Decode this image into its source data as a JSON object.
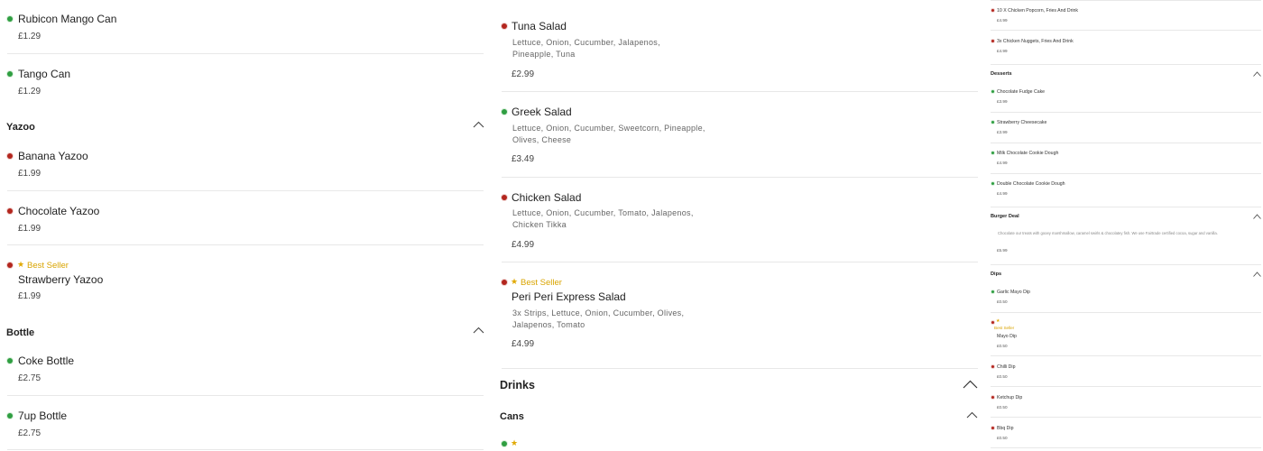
{
  "col1": {
    "items_top": [
      {
        "name": "Rubicon Mango Can",
        "price": "£1.29"
      },
      {
        "name": "Tango Can",
        "price": "£1.29"
      }
    ],
    "yazoo": {
      "title": "Yazoo",
      "items": [
        {
          "name": "Banana Yazoo",
          "price": "£1.99"
        },
        {
          "name": "Chocolate Yazoo",
          "price": "£1.99"
        },
        {
          "badge": "Best Seller",
          "name": "Strawberry Yazoo",
          "price": "£1.99"
        }
      ]
    },
    "bottle": {
      "title": "Bottle",
      "items": [
        {
          "name": "Coke Bottle",
          "price": "£2.75"
        },
        {
          "name": "7up Bottle",
          "price": "£2.75"
        }
      ]
    }
  },
  "col2": {
    "items": [
      {
        "name": "Tuna Salad",
        "desc": "Lettuce, Onion, Cucumber, Jalapenos, Pineapple, Tuna",
        "price": "£2.99"
      },
      {
        "name": "Greek Salad",
        "desc": "Lettuce, Onion, Cucumber, Sweetcorn, Pineapple, Olives, Cheese",
        "price": "£3.49"
      },
      {
        "name": "Chicken Salad",
        "desc": "Lettuce, Onion, Cucumber, Tomato, Jalapenos, Chicken Tikka",
        "price": "£4.99"
      },
      {
        "badge": "Best Seller",
        "name": "Peri Peri Express Salad",
        "desc": "3x Strips, Lettuce, Onion, Cucumber, Olives, Jalapenos, Tomato",
        "price": "£4.99"
      }
    ],
    "drinks_title": "Drinks",
    "cans_title": "Cans"
  },
  "col3": {
    "top_items": [
      {
        "name": "10 X Chicken Popcorn, Fries And Drink",
        "price": "£4.99"
      },
      {
        "name": "3x Chicken Nuggets, Fries And Drink",
        "price": "£4.99"
      }
    ],
    "desserts": {
      "title": "Desserts",
      "items": [
        {
          "name": "Chocolate Fudge Cake",
          "price": "£3.99"
        },
        {
          "name": "Strawberry Cheesecake",
          "price": "£3.99"
        },
        {
          "name": "Milk Chocolate Cookie Dough",
          "price": "£4.99"
        },
        {
          "name": "Double Chocolate Cookie Dough",
          "price": "£4.99"
        }
      ]
    },
    "burger_deal": {
      "title": "Burger Deal",
      "desc": "Chocolate our treats with gooey marshmallow, caramel swirls & chocolatey fish. We use Fairtrade certified cocoa, sugar and vanilla.",
      "price": "£5.99"
    },
    "dips": {
      "title": "Dips",
      "items": [
        {
          "name": "Garlic Mayo Dip",
          "price": "£0.50"
        },
        {
          "badge": "Best Seller",
          "name": "Mayo Dip",
          "price": "£0.50"
        },
        {
          "name": "Chilli Dip",
          "price": "£0.50"
        },
        {
          "name": "Ketchup Dip",
          "price": "£0.50"
        },
        {
          "name": "Bbq Dip",
          "price": "£0.50"
        }
      ]
    }
  },
  "colors": {
    "veg": "#2f9e41",
    "nonveg": "#b3261e",
    "bestseller": "#d9a400",
    "divider": "#e8e8e8"
  },
  "icons": {
    "chevron": "chevron-up-icon",
    "star": "star-icon",
    "veg": "veg-dot-icon",
    "nonveg": "nonveg-dot-icon"
  }
}
